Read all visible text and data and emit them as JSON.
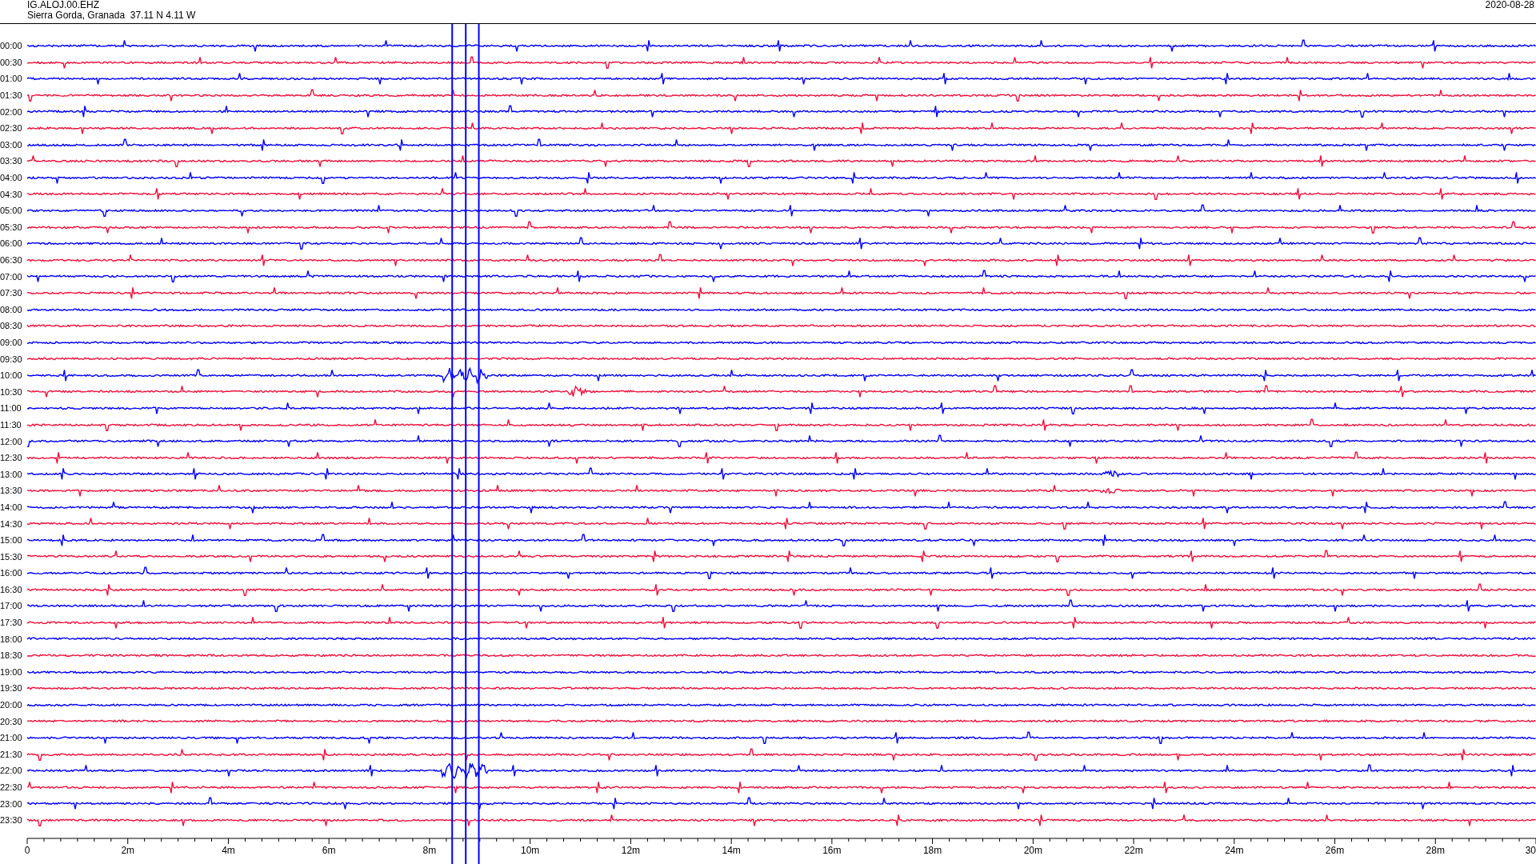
{
  "header": {
    "station": "IG.ALOJ.00.EHZ",
    "location": "Sierra Gorda, Granada  37.11 N 4.11 W",
    "date": "2020-08-28"
  },
  "rows": [
    {
      "time": "00:00",
      "color": "#0000ff"
    },
    {
      "time": "00:30",
      "color": "#f0103c"
    },
    {
      "time": "01:00",
      "color": "#0000ff"
    },
    {
      "time": "01:30",
      "color": "#f0103c"
    },
    {
      "time": "02:00",
      "color": "#0000ff"
    },
    {
      "time": "02:30",
      "color": "#f0103c"
    },
    {
      "time": "03:00",
      "color": "#0000ff"
    },
    {
      "time": "03:30",
      "color": "#f0103c"
    },
    {
      "time": "04:00",
      "color": "#0000ff"
    },
    {
      "time": "04:30",
      "color": "#f0103c"
    },
    {
      "time": "05:00",
      "color": "#0000ff"
    },
    {
      "time": "05:30",
      "color": "#f0103c"
    },
    {
      "time": "06:00",
      "color": "#0000ff"
    },
    {
      "time": "06:30",
      "color": "#f0103c"
    },
    {
      "time": "07:00",
      "color": "#0000ff"
    },
    {
      "time": "07:30",
      "color": "#f0103c"
    },
    {
      "time": "08:00",
      "color": "#0000ff"
    },
    {
      "time": "08:30",
      "color": "#f0103c"
    },
    {
      "time": "09:00",
      "color": "#0000ff"
    },
    {
      "time": "09:30",
      "color": "#f0103c"
    },
    {
      "time": "10:00",
      "color": "#0000ff"
    },
    {
      "time": "10:30",
      "color": "#f0103c"
    },
    {
      "time": "11:00",
      "color": "#0000ff"
    },
    {
      "time": "11:30",
      "color": "#f0103c"
    },
    {
      "time": "12:00",
      "color": "#0000ff"
    },
    {
      "time": "12:30",
      "color": "#f0103c"
    },
    {
      "time": "13:00",
      "color": "#0000ff"
    },
    {
      "time": "13:30",
      "color": "#f0103c"
    },
    {
      "time": "14:00",
      "color": "#0000ff"
    },
    {
      "time": "14:30",
      "color": "#f0103c"
    },
    {
      "time": "15:00",
      "color": "#0000ff"
    },
    {
      "time": "15:30",
      "color": "#f0103c"
    },
    {
      "time": "16:00",
      "color": "#0000ff"
    },
    {
      "time": "16:30",
      "color": "#f0103c"
    },
    {
      "time": "17:00",
      "color": "#0000ff"
    },
    {
      "time": "17:30",
      "color": "#f0103c"
    },
    {
      "time": "18:00",
      "color": "#0000ff"
    },
    {
      "time": "18:30",
      "color": "#f0103c"
    },
    {
      "time": "19:00",
      "color": "#0000ff"
    },
    {
      "time": "19:30",
      "color": "#f0103c"
    },
    {
      "time": "20:00",
      "color": "#0000ff"
    },
    {
      "time": "20:30",
      "color": "#f0103c"
    },
    {
      "time": "21:00",
      "color": "#0000ff"
    },
    {
      "time": "21:30",
      "color": "#f0103c"
    },
    {
      "time": "22:00",
      "color": "#0000ff"
    },
    {
      "time": "22:30",
      "color": "#f0103c"
    },
    {
      "time": "23:00",
      "color": "#0000ff"
    },
    {
      "time": "23:30",
      "color": "#f0103c"
    }
  ],
  "x_axis": {
    "ticks": [
      "0",
      "2m",
      "4m",
      "6m",
      "8m",
      "10m",
      "12m",
      "14m",
      "16m",
      "18m",
      "20m",
      "22m",
      "24m",
      "26m",
      "28m",
      "30"
    ]
  }
}
